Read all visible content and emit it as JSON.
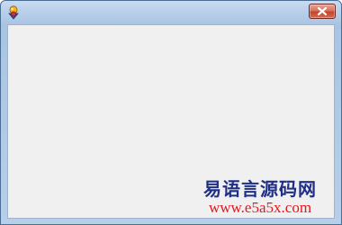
{
  "window": {
    "title": "",
    "close_symbol": "×"
  },
  "icons": {
    "app": "app-icon",
    "close": "close-icon"
  },
  "watermark": {
    "title": "易语言源码网",
    "url": "www.e5a5x.com"
  },
  "colors": {
    "titlebar": "#b9d0ea",
    "client_background": "#f0f0f0",
    "close_button": "#c4452f",
    "watermark_title": "#1f2f86",
    "watermark_url": "#e8151d"
  }
}
